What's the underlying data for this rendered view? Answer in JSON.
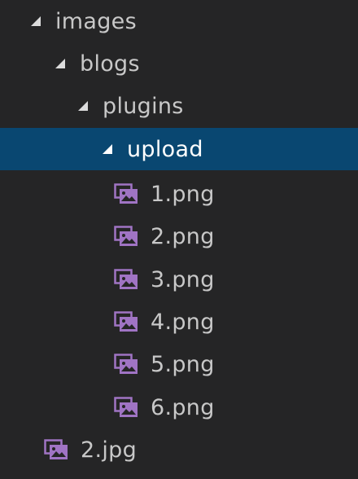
{
  "explorer": {
    "items": [
      {
        "label": "images",
        "kind": "folder",
        "expanded": true,
        "selected": false
      },
      {
        "label": "blogs",
        "kind": "folder",
        "expanded": true,
        "selected": false
      },
      {
        "label": "plugins",
        "kind": "folder",
        "expanded": true,
        "selected": false
      },
      {
        "label": "upload",
        "kind": "folder",
        "expanded": true,
        "selected": true
      },
      {
        "label": "1.png",
        "kind": "image",
        "selected": false
      },
      {
        "label": "2.png",
        "kind": "image",
        "selected": false
      },
      {
        "label": "3.png",
        "kind": "image",
        "selected": false
      },
      {
        "label": "4.png",
        "kind": "image",
        "selected": false
      },
      {
        "label": "5.png",
        "kind": "image",
        "selected": false
      },
      {
        "label": "6.png",
        "kind": "image",
        "selected": false
      },
      {
        "label": "2.jpg",
        "kind": "image",
        "selected": false
      }
    ]
  },
  "colors": {
    "background": "#252526",
    "selection": "#094771",
    "text": "#c8c8c8",
    "selected_text": "#ffffff",
    "image_icon": "#a074c4"
  },
  "icons": {
    "expanded_folder": "triangle-expanded-icon",
    "image_file": "image-file-icon"
  }
}
